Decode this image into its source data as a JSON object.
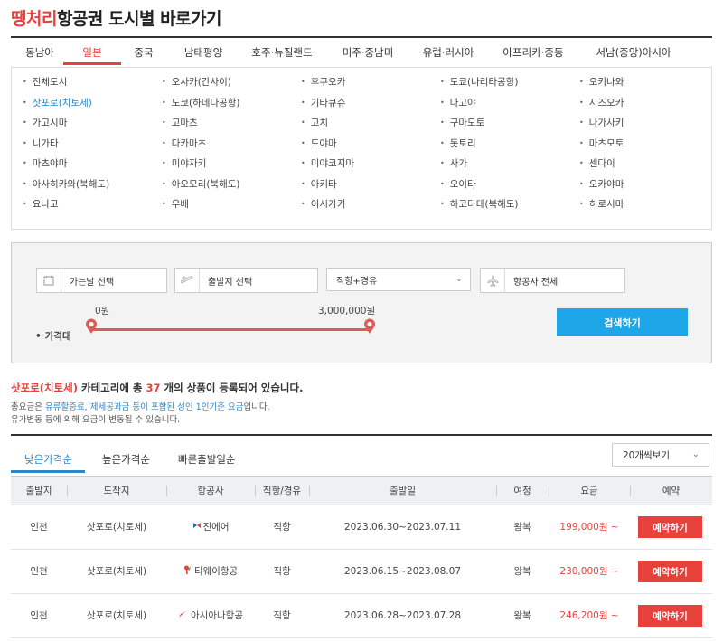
{
  "header": {
    "brand": "땡처리",
    "title_rest": "항공권 도시별 바로가기"
  },
  "region_tabs": [
    {
      "label": "동남아"
    },
    {
      "label": "일본",
      "active": true
    },
    {
      "label": "중국"
    },
    {
      "label": "남태평양"
    },
    {
      "label": "호주·뉴질랜드"
    },
    {
      "label": "미주·중남미"
    },
    {
      "label": "유럽·러시아"
    },
    {
      "label": "아프리카·중동"
    },
    {
      "label": "서남(중앙)아시아"
    }
  ],
  "cities": [
    "전체도시",
    "오사카(간사이)",
    "후쿠오카",
    "도쿄(나리타공항)",
    "오키나와",
    "삿포로(치토세)",
    "도쿄(하네다공항)",
    "기타큐슈",
    "나고야",
    "시즈오카",
    "가고시마",
    "고마츠",
    "고치",
    "구마모토",
    "나가사키",
    "니가타",
    "다카마츠",
    "도야마",
    "돗토리",
    "마츠모토",
    "마츠야마",
    "미야자키",
    "미야코지마",
    "사가",
    "센다이",
    "아사히카와(북해도)",
    "아오모리(북해도)",
    "아키타",
    "오이타",
    "오카야마",
    "요나고",
    "우베",
    "이시가키",
    "하코다테(북해도)",
    "히로시마"
  ],
  "active_city": "삿포로(치토세)",
  "search": {
    "date_placeholder": "가는날 선택",
    "departure_placeholder": "출발지 선택",
    "route_type": "직항+경유",
    "airline": "항공사 전체",
    "price_label": "가격대",
    "price_min": "0원",
    "price_max": "3,000,000원",
    "search_button": "검색하기"
  },
  "result": {
    "category": "삿포로(치토세)",
    "text_a": " 카테고리에 총 ",
    "count": "37",
    "text_b": " 개의 상품이 등록되어 있습니다.",
    "note1_a": "총요금은 ",
    "note1_b": "유류할증료, 제세공과금 등이 포함된 성인 1인기준 요금",
    "note1_c": "입니다.",
    "note2": "유가변동 등에 의해 요금이 변동될 수 있습니다."
  },
  "sort_tabs": [
    {
      "label": "낮은가격순",
      "active": true
    },
    {
      "label": "높은가격순"
    },
    {
      "label": "빠른출발일순"
    }
  ],
  "page_size": "20개씩보기",
  "table": {
    "headers": [
      "출발지",
      "도착지",
      "항공사",
      "직항/경유",
      "출발일",
      "여정",
      "요금",
      "예약"
    ],
    "rows": [
      {
        "from": "인천",
        "to": "삿포로(치토세)",
        "airline": "진에어",
        "airline_icon": "jinair-logo-icon",
        "route": "직항",
        "dates": "2023.06.30~2023.07.11",
        "trip": "왕복",
        "price": "199,000원 ~",
        "book": "예약하기"
      },
      {
        "from": "인천",
        "to": "삿포로(치토세)",
        "airline": "티웨이항공",
        "airline_icon": "tway-logo-icon",
        "route": "직항",
        "dates": "2023.06.15~2023.08.07",
        "trip": "왕복",
        "price": "230,000원 ~",
        "book": "예약하기"
      },
      {
        "from": "인천",
        "to": "삿포로(치토세)",
        "airline": "아시아나항공",
        "airline_icon": "asiana-logo-icon",
        "route": "직항",
        "dates": "2023.06.28~2023.07.28",
        "trip": "왕복",
        "price": "246,200원 ~",
        "book": "예약하기"
      }
    ]
  },
  "colors": {
    "accent_red": "#e8413c",
    "accent_blue": "#2a88c8",
    "search_button": "#1ea7e8"
  }
}
